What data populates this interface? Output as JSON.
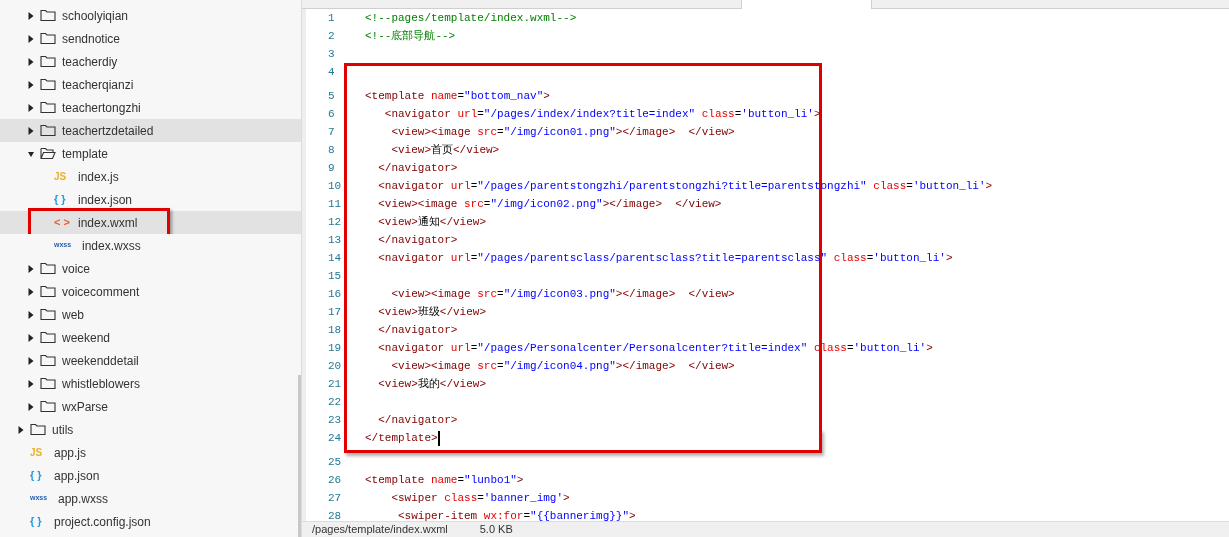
{
  "sidebar": {
    "folder_items": [
      {
        "kind": "folder",
        "label": "schoolyiqian",
        "expanded": false,
        "selected": false,
        "highlighted": false
      },
      {
        "kind": "folder",
        "label": "sendnotice",
        "expanded": false,
        "selected": false,
        "highlighted": false
      },
      {
        "kind": "folder",
        "label": "teacherdiy",
        "expanded": false,
        "selected": false,
        "highlighted": false
      },
      {
        "kind": "folder",
        "label": "teacherqianzi",
        "expanded": false,
        "selected": false,
        "highlighted": false
      },
      {
        "kind": "folder",
        "label": "teachertongzhi",
        "expanded": false,
        "selected": false,
        "highlighted": false
      },
      {
        "kind": "folder",
        "label": "teachertzdetailed",
        "expanded": false,
        "selected": true,
        "highlighted": false
      },
      {
        "kind": "folder",
        "label": "template",
        "expanded": true,
        "selected": false,
        "highlighted": false,
        "children": [
          {
            "kind": "js",
            "icon": "JS",
            "label": "index.js",
            "selected": false,
            "highlighted": false
          },
          {
            "kind": "json",
            "icon": "{ }",
            "label": "index.json",
            "selected": false,
            "highlighted": false
          },
          {
            "kind": "wxml",
            "icon": "< >",
            "label": "index.wxml",
            "selected": true,
            "highlighted": true
          },
          {
            "kind": "wxss",
            "icon": "wxss",
            "label": "index.wxss",
            "selected": false,
            "highlighted": false
          }
        ]
      },
      {
        "kind": "folder",
        "label": "voice",
        "expanded": false,
        "selected": false,
        "highlighted": false
      },
      {
        "kind": "folder",
        "label": "voicecomment",
        "expanded": false,
        "selected": false,
        "highlighted": false
      },
      {
        "kind": "folder",
        "label": "web",
        "expanded": false,
        "selected": false,
        "highlighted": false
      },
      {
        "kind": "folder",
        "label": "weekend",
        "expanded": false,
        "selected": false,
        "highlighted": false
      },
      {
        "kind": "folder",
        "label": "weekenddetail",
        "expanded": false,
        "selected": false,
        "highlighted": false
      },
      {
        "kind": "folder",
        "label": "whistleblowers",
        "expanded": false,
        "selected": false,
        "highlighted": false
      },
      {
        "kind": "folder",
        "label": "wxParse",
        "expanded": false,
        "selected": false,
        "highlighted": false
      }
    ],
    "root_items": [
      {
        "kind": "folder",
        "label": "utils",
        "expanded": false,
        "selected": false,
        "highlighted": false
      },
      {
        "kind": "js",
        "icon": "JS",
        "label": "app.js",
        "selected": false,
        "highlighted": false
      },
      {
        "kind": "json",
        "icon": "{ }",
        "label": "app.json",
        "selected": false,
        "highlighted": false
      },
      {
        "kind": "wxss",
        "icon": "wxss",
        "label": "app.wxss",
        "selected": false,
        "highlighted": false
      },
      {
        "kind": "json",
        "icon": "{ }",
        "label": "project.config.json",
        "selected": false,
        "highlighted": false
      }
    ]
  },
  "editor": {
    "lines": [
      {
        "number": "1",
        "boxed": false,
        "tokens": [
          {
            "kind": "comment",
            "text": "<!--pages/template/index.wxml-->"
          }
        ]
      },
      {
        "number": "2",
        "boxed": false,
        "tokens": [
          {
            "kind": "comment",
            "text": "<!--底部导航-->"
          }
        ]
      },
      {
        "number": "3",
        "boxed": false
      },
      {
        "number": "4",
        "boxed": true
      },
      {
        "number": "5",
        "boxed": true,
        "tokens": [
          {
            "kind": "tag",
            "text": "<template"
          },
          {
            "kind": "attr",
            "text": " name"
          },
          {
            "kind": "plain",
            "text": "="
          },
          {
            "kind": "string",
            "text": "\"bottom_nav\""
          },
          {
            "kind": "tag",
            "text": ">"
          }
        ]
      },
      {
        "number": "6",
        "boxed": true,
        "tokens": [
          {
            "kind": "tag",
            "text": "   <navigator"
          },
          {
            "kind": "attr",
            "text": " url"
          },
          {
            "kind": "plain",
            "text": "="
          },
          {
            "kind": "string",
            "text": "\"/pages/index/index?title=index\""
          },
          {
            "kind": "attr",
            "text": " class"
          },
          {
            "kind": "plain",
            "text": "="
          },
          {
            "kind": "string",
            "text": "'button_li'"
          },
          {
            "kind": "tag",
            "text": ">"
          }
        ]
      },
      {
        "number": "7",
        "boxed": true,
        "tokens": [
          {
            "kind": "tag",
            "text": "    <view><image"
          },
          {
            "kind": "attr",
            "text": " src"
          },
          {
            "kind": "plain",
            "text": "="
          },
          {
            "kind": "string",
            "text": "\"/img/icon01.png\""
          },
          {
            "kind": "tag",
            "text": "></image>  </view>"
          }
        ]
      },
      {
        "number": "8",
        "boxed": true,
        "tokens": [
          {
            "kind": "tag",
            "text": "    <view>"
          },
          {
            "kind": "plain",
            "text": "首页"
          },
          {
            "kind": "tag",
            "text": "</view>"
          }
        ]
      },
      {
        "number": "9",
        "boxed": true,
        "tokens": [
          {
            "kind": "tag",
            "text": "  </navigator>"
          }
        ]
      },
      {
        "number": "10",
        "boxed": true,
        "tokens": [
          {
            "kind": "tag",
            "text": "  <navigator"
          },
          {
            "kind": "attr",
            "text": " url"
          },
          {
            "kind": "plain",
            "text": "="
          },
          {
            "kind": "string",
            "text": "\"/pages/parentstongzhi/parentstongzhi?title=parentstongzhi\""
          },
          {
            "kind": "attr",
            "text": " class"
          },
          {
            "kind": "plain",
            "text": "="
          },
          {
            "kind": "string",
            "text": "'button_li'"
          },
          {
            "kind": "tag",
            "text": ">"
          }
        ]
      },
      {
        "number": "11",
        "boxed": true,
        "tokens": [
          {
            "kind": "tag",
            "text": "  <view><image"
          },
          {
            "kind": "attr",
            "text": " src"
          },
          {
            "kind": "plain",
            "text": "="
          },
          {
            "kind": "string",
            "text": "\"/img/icon02.png\""
          },
          {
            "kind": "tag",
            "text": "></image>  </view>"
          }
        ]
      },
      {
        "number": "12",
        "boxed": true,
        "tokens": [
          {
            "kind": "tag",
            "text": "  <view>"
          },
          {
            "kind": "plain",
            "text": "通知"
          },
          {
            "kind": "tag",
            "text": "</view>"
          }
        ]
      },
      {
        "number": "13",
        "boxed": true,
        "tokens": [
          {
            "kind": "tag",
            "text": "  </navigator>"
          }
        ]
      },
      {
        "number": "14",
        "boxed": true,
        "tokens": [
          {
            "kind": "tag",
            "text": "  <navigator"
          },
          {
            "kind": "attr",
            "text": " url"
          },
          {
            "kind": "plain",
            "text": "="
          },
          {
            "kind": "string",
            "text": "\"/pages/parentsclass/parentsclass?title=parentsclass\""
          },
          {
            "kind": "attr",
            "text": " class"
          },
          {
            "kind": "plain",
            "text": "="
          },
          {
            "kind": "string",
            "text": "'button_li'"
          },
          {
            "kind": "tag",
            "text": ">"
          }
        ]
      },
      {
        "number": "15",
        "boxed": true
      },
      {
        "number": "16",
        "boxed": true,
        "tokens": [
          {
            "kind": "tag",
            "text": "    <view><image"
          },
          {
            "kind": "attr",
            "text": " src"
          },
          {
            "kind": "plain",
            "text": "="
          },
          {
            "kind": "string",
            "text": "\"/img/icon03.png\""
          },
          {
            "kind": "tag",
            "text": "></image>  </view>"
          }
        ]
      },
      {
        "number": "17",
        "boxed": true,
        "tokens": [
          {
            "kind": "tag",
            "text": "  <view>"
          },
          {
            "kind": "plain",
            "text": "班级"
          },
          {
            "kind": "tag",
            "text": "</view>"
          }
        ]
      },
      {
        "number": "18",
        "boxed": true,
        "tokens": [
          {
            "kind": "tag",
            "text": "  </navigator>"
          }
        ]
      },
      {
        "number": "19",
        "boxed": true,
        "tokens": [
          {
            "kind": "tag",
            "text": "  <navigator"
          },
          {
            "kind": "attr",
            "text": " url"
          },
          {
            "kind": "plain",
            "text": "="
          },
          {
            "kind": "string",
            "text": "\"/pages/Personalcenter/Personalcenter?title=index\""
          },
          {
            "kind": "attr",
            "text": " class"
          },
          {
            "kind": "plain",
            "text": "="
          },
          {
            "kind": "string",
            "text": "'button_li'"
          },
          {
            "kind": "tag",
            "text": ">"
          }
        ]
      },
      {
        "number": "20",
        "boxed": true,
        "tokens": [
          {
            "kind": "tag",
            "text": "    <view><image"
          },
          {
            "kind": "attr",
            "text": " src"
          },
          {
            "kind": "plain",
            "text": "="
          },
          {
            "kind": "string",
            "text": "\"/img/icon04.png\""
          },
          {
            "kind": "tag",
            "text": "></image>  </view>"
          }
        ]
      },
      {
        "number": "21",
        "boxed": true,
        "tokens": [
          {
            "kind": "tag",
            "text": "  <view>"
          },
          {
            "kind": "plain",
            "text": "我的"
          },
          {
            "kind": "tag",
            "text": "</view>"
          }
        ]
      },
      {
        "number": "22",
        "boxed": true
      },
      {
        "number": "23",
        "boxed": true,
        "tokens": [
          {
            "kind": "tag",
            "text": "  </navigator>"
          }
        ]
      },
      {
        "number": "24",
        "boxed": true,
        "cursor": true,
        "tokens": [
          {
            "kind": "tag",
            "text": "</template>"
          }
        ]
      },
      {
        "number": "25",
        "boxed": false
      },
      {
        "number": "26",
        "boxed": false,
        "tokens": [
          {
            "kind": "tag",
            "text": "<template"
          },
          {
            "kind": "attr",
            "text": " name"
          },
          {
            "kind": "plain",
            "text": "="
          },
          {
            "kind": "string",
            "text": "\"lunbo1\""
          },
          {
            "kind": "tag",
            "text": ">"
          }
        ]
      },
      {
        "number": "27",
        "boxed": false,
        "tokens": [
          {
            "kind": "tag",
            "text": "    <swiper"
          },
          {
            "kind": "attr",
            "text": " class"
          },
          {
            "kind": "plain",
            "text": "="
          },
          {
            "kind": "string",
            "text": "'banner_img'"
          },
          {
            "kind": "tag",
            "text": ">"
          }
        ]
      },
      {
        "number": "28",
        "boxed": false,
        "tokens": [
          {
            "kind": "tag",
            "text": "     <swiper-item"
          },
          {
            "kind": "attr",
            "text": " wx:for"
          },
          {
            "kind": "plain",
            "text": "="
          },
          {
            "kind": "string",
            "text": "\"{{bannerimg}}\""
          },
          {
            "kind": "tag",
            "text": ">"
          }
        ]
      }
    ]
  },
  "status_bar": {
    "path": "/pages/template/index.wxml",
    "size": "5.0 KB"
  }
}
